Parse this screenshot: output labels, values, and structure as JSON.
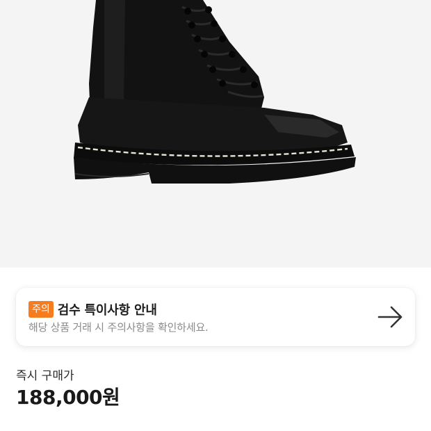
{
  "product": {
    "image_icon": "black-lace-up-combat-boot"
  },
  "notice": {
    "badge": "주의",
    "title": "검수 특이사항 안내",
    "description": "해당 상품 거래 시 주의사항을 확인하세요.",
    "arrow_icon": "arrow-right-icon",
    "badge_color": "#f57c1f"
  },
  "price": {
    "label": "즉시 구매가",
    "value": "188,000원"
  }
}
